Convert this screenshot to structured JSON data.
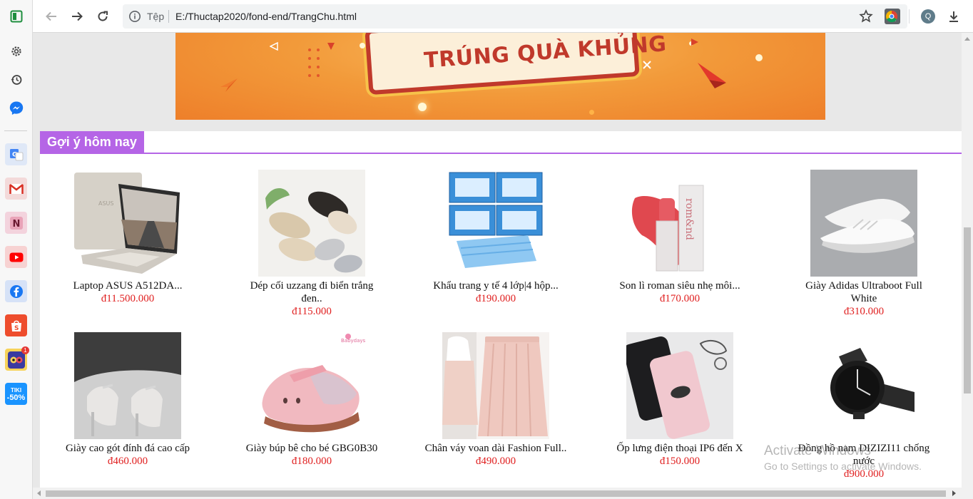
{
  "browser": {
    "scheme_label": "Tệp",
    "url": "E:/Thuctap2020/fond-end/TrangChu.html",
    "profile_initial": "Q"
  },
  "sidebar": {
    "badge_count": "1",
    "tiki_label_top": "TIKI",
    "tiki_label_bottom": "-50%"
  },
  "banner": {
    "headline": "TRÚNG QUÀ KHỦNG"
  },
  "section": {
    "title": "Gợi ý hôm nay"
  },
  "products": [
    {
      "name": "Laptop ASUS A512DA...",
      "price": "đ11.500.000"
    },
    {
      "name": "Dép cối uzzang đi biển trắng đen..",
      "price": "đ115.000"
    },
    {
      "name": "Khẩu trang y tế 4 lớp|4 hộp...",
      "price": "đ190.000"
    },
    {
      "name": "Son lì roman siêu nhẹ môi...",
      "price": "đ170.000"
    },
    {
      "name": "Giày Adidas Ultraboot Full White",
      "price": "đ310.000"
    },
    {
      "name": "Giày cao gót đính đá cao cấp",
      "price": "đ460.000"
    },
    {
      "name": "Giày búp bê cho bé GBG0B30",
      "price": "đ180.000"
    },
    {
      "name": "Chân váy voan dài Fashion Full..",
      "price": "đ490.000"
    },
    {
      "name": "Ốp lưng điện thoại IP6 đến X",
      "price": "đ150.000"
    },
    {
      "name": "Đồng hồ nam DIZIZI11 chống nước",
      "price": "đ900.000"
    }
  ],
  "product_image_labels": {
    "laptop_brand": "ASUS",
    "lipstick_brand": "rom&nd",
    "kids_brand": "Babydays"
  },
  "watermark": {
    "line1": "Activate Windows",
    "line2": "Go to Settings to activate Windows."
  }
}
